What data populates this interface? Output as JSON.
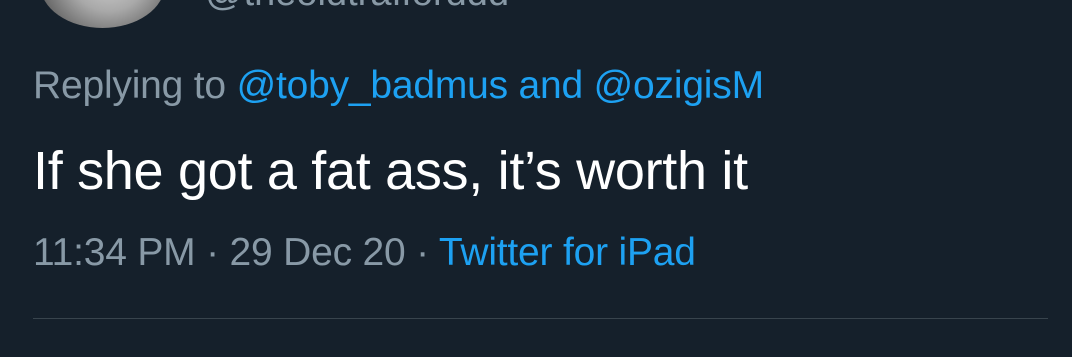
{
  "author": {
    "handle": "@theoldtrafforddd"
  },
  "reply": {
    "prefix": "Replying to",
    "mention_1": "@toby_badmus",
    "conjunction": "and",
    "mention_2": "@ozigisM"
  },
  "tweet": {
    "text": "If she got a fat ass, it’s worth it",
    "time": "11:34 PM",
    "separator": "·",
    "date": "29 Dec 20",
    "source": "Twitter for iPad"
  },
  "colors": {
    "background": "#15202b",
    "secondary_text": "#8899a6",
    "link": "#1da1f2",
    "primary_text": "#ffffff",
    "divider": "#38444d"
  }
}
